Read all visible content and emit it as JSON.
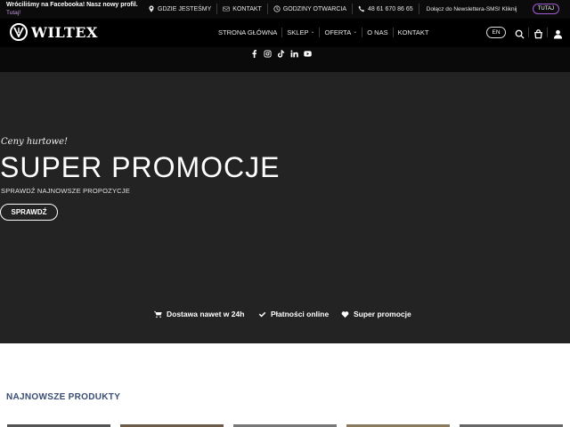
{
  "topbar": {
    "notice_title": "Wróciliśmy na Facebooka! Nasz nowy profil.",
    "notice_link": "Tutaj!",
    "links": [
      {
        "icon": "map-pin-icon",
        "label": "GDZIE JESTEŚMY"
      },
      {
        "icon": "mail-icon",
        "label": "KONTAKT"
      },
      {
        "icon": "clock-icon",
        "label": "GODZINY OTWARCIA"
      },
      {
        "icon": "phone-icon",
        "label": "48 61 670 86 65"
      }
    ],
    "newsletter_text": "Dołącz do Newslettera-SMS! Kliknij",
    "newsletter_button": "TUTAJ"
  },
  "header": {
    "brand": "WILTEX",
    "nav": [
      {
        "label": "STRONA GŁÓWNA",
        "dropdown": false
      },
      {
        "label": "SKLEP",
        "dropdown": true
      },
      {
        "label": "OFERTA",
        "dropdown": true
      },
      {
        "label": "O NAS",
        "dropdown": false
      },
      {
        "label": "KONTAKT",
        "dropdown": false
      }
    ],
    "lang": "EN",
    "icons": [
      "search-icon",
      "cart-icon",
      "user-icon"
    ]
  },
  "social": {
    "icons": [
      "facebook-icon",
      "instagram-icon",
      "tiktok-icon",
      "linkedin-icon",
      "youtube-icon"
    ]
  },
  "hero": {
    "kicker": "Ceny hurtowe!",
    "title": "SUPER PROMOCJE",
    "subtitle": "SPRAWDŹ NAJNOWSZE PROPOZYCJE",
    "button": "SPRAWDŹ",
    "usps": [
      {
        "icon": "cart-icon",
        "label": "Dostawa nawet w 24h"
      },
      {
        "icon": "check-icon",
        "label": "Płatności online"
      },
      {
        "icon": "heart-icon",
        "label": "Super promocje"
      }
    ]
  },
  "products": {
    "title": "NAJNOWSZE PRODUKTY"
  },
  "colors": {
    "accent": "#a35cd6",
    "hero_bg": "#232323",
    "header_bg": "#000000",
    "section_title": "#3a4d73"
  }
}
